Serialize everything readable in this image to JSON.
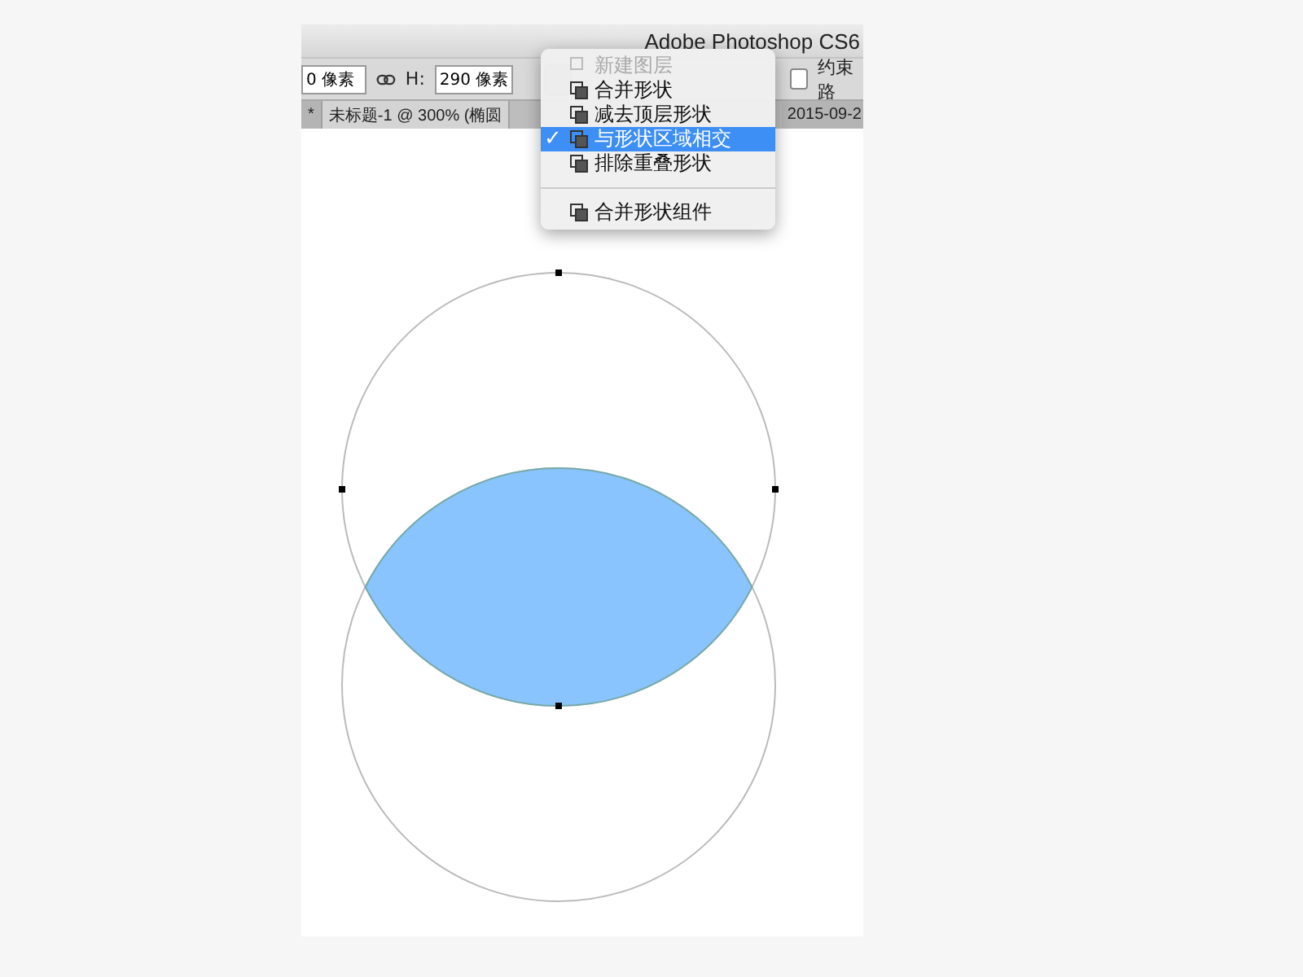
{
  "window": {
    "title": "Adobe Photoshop CS6"
  },
  "options_bar": {
    "width_value": "0 像素",
    "height_label": "H:",
    "height_value": "290 像素",
    "checkbox_label": "约束路",
    "checkbox_checked": false
  },
  "tabs": [
    {
      "label": "*",
      "selected": false
    },
    {
      "label": "未标题-1 @ 300% (椭圆",
      "selected": true
    },
    {
      "label": "2015-09-2",
      "selected": false
    }
  ],
  "menu": {
    "check_mark": "✓",
    "items": [
      {
        "label": "新建图层",
        "kind": "item",
        "disabled": true,
        "selected": false
      },
      {
        "label": "合并形状",
        "kind": "item",
        "disabled": false,
        "selected": false
      },
      {
        "label": "减去顶层形状",
        "kind": "item",
        "disabled": false,
        "selected": false
      },
      {
        "label": "与形状区域相交",
        "kind": "item",
        "disabled": false,
        "selected": true
      },
      {
        "label": "排除重叠形状",
        "kind": "item",
        "disabled": false,
        "selected": false
      },
      {
        "kind": "separator"
      },
      {
        "label": "合并形状组件",
        "kind": "item",
        "disabled": false,
        "selected": false
      }
    ]
  }
}
